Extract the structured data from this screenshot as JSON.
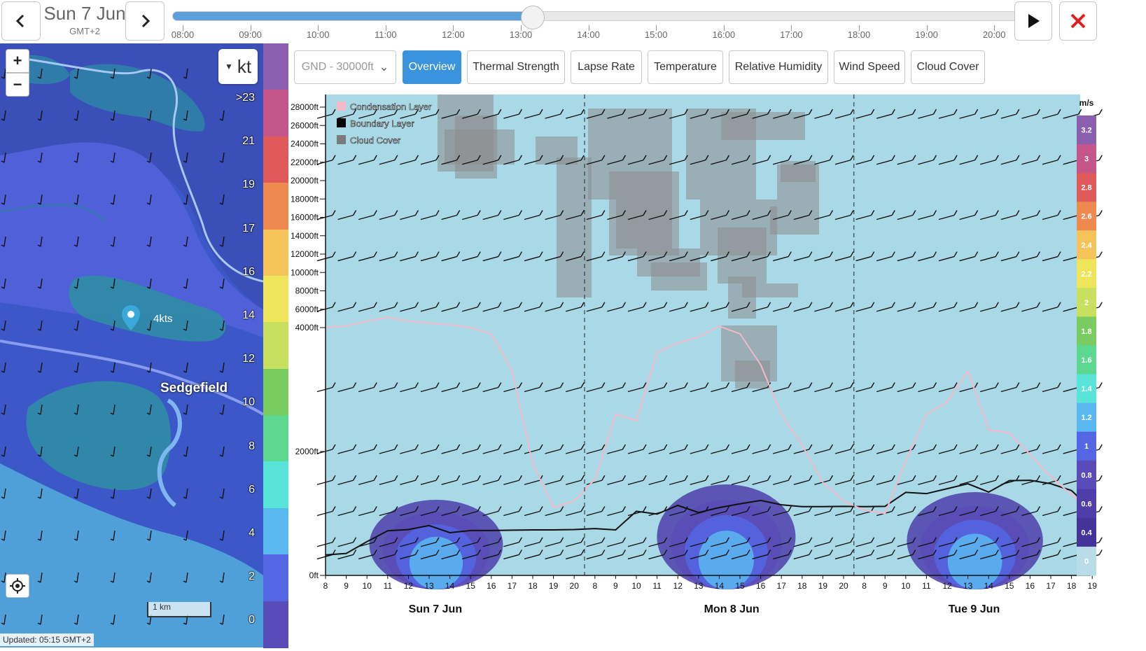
{
  "header": {
    "date": "Sun 7 Jun",
    "timezone": "GMT+2",
    "prev_icon": "chevron-left-icon",
    "next_icon": "chevron-right-icon",
    "play_icon": "play-icon",
    "close_icon": "close-icon",
    "close_color": "#e02020",
    "timeline_progress": 0.41,
    "timeline_labels": [
      "08:00",
      "09:00",
      "10:00",
      "11:00",
      "12:00",
      "13:00",
      "14:00",
      "15:00",
      "16:00",
      "17:00",
      "18:00",
      "19:00",
      "20:00"
    ]
  },
  "map": {
    "zoom_in": "+",
    "zoom_out": "−",
    "unit": "kt",
    "marker_label": "4kts",
    "place_label": "Sedgefield",
    "updated": "Updated: 05:15 GMT+2",
    "scale": "1 km",
    "locate_icon": "locate-icon",
    "legend_labels": [
      ">23",
      "21",
      "19",
      "17",
      "16",
      "14",
      "12",
      "10",
      "8",
      "6",
      "4",
      "2",
      "0"
    ],
    "legend_colors": [
      "#8a5fb0",
      "#c4568a",
      "#e05a5a",
      "#ee8a50",
      "#f4c45a",
      "#eee55a",
      "#c8e060",
      "#78cc60",
      "#5cd890",
      "#58e4d8",
      "#5ab8f0",
      "#5466e4",
      "#5a4cb8"
    ]
  },
  "tabs": {
    "altitude": "GND - 30000ft",
    "items": [
      "Overview",
      "Thermal Strength",
      "Lapse Rate",
      "Temperature",
      "Relative Humidity",
      "Wind Speed",
      "Cloud Cover"
    ],
    "active": "Overview"
  },
  "chart_data": {
    "type": "area",
    "legend": [
      "Condensation Layer",
      "Boundary Layer",
      "Cloud Cover"
    ],
    "legend_colors": [
      "#f4b8c8",
      "#000000",
      "#7a7a7a"
    ],
    "y_tick_labels": [
      "28000ft",
      "26000ft",
      "24000ft",
      "22000ft",
      "20000ft",
      "18000ft",
      "16000ft",
      "14000ft",
      "12000ft",
      "10000ft",
      "8000ft",
      "6000ft",
      "4000ft",
      "2000ft",
      "0ft"
    ],
    "x_tick_labels": [
      "8",
      "9",
      "10",
      "11",
      "12",
      "13",
      "14",
      "15",
      "16",
      "17",
      "18",
      "19",
      "20",
      "8",
      "9",
      "10",
      "11",
      "12",
      "13",
      "14",
      "15",
      "16",
      "17",
      "18",
      "19",
      "20",
      "8",
      "9",
      "10",
      "11",
      "12",
      "13",
      "14",
      "15",
      "16",
      "17",
      "18",
      "19"
    ],
    "day_labels": [
      "Sun 7 Jun",
      "Mon 8 Jun",
      "Tue 9 Jun"
    ],
    "unit": "m/s",
    "scale_labels": [
      "3.2",
      "3",
      "2.8",
      "2.6",
      "2.4",
      "2.2",
      "2",
      "1.8",
      "1.6",
      "1.4",
      "1.2",
      "1",
      "0.8",
      "0.6",
      "0.4",
      "0"
    ],
    "scale_colors": [
      "#8a5fb0",
      "#c4568a",
      "#e05a5a",
      "#ee8a50",
      "#f4c45a",
      "#eee55a",
      "#c8e060",
      "#78cc60",
      "#5cd890",
      "#58e4d8",
      "#5ab8f0",
      "#5466e4",
      "#5a4cb8",
      "#4e3eaa",
      "#443398",
      "#b8dce8"
    ],
    "plot_background": "#a9d8e6",
    "boundary_layer": [
      330,
      355,
      545,
      720,
      740,
      805,
      690,
      725,
      725,
      730,
      735,
      735,
      740,
      755,
      735,
      1035,
      990,
      1130,
      1015,
      1095,
      1155,
      1210,
      1140,
      1110,
      1110,
      1115,
      1110,
      1115,
      1340,
      1320,
      1400,
      1480,
      1345,
      1530,
      1535,
      1480,
      1370,
      1055
    ],
    "condensation_layer": [
      4000,
      4200,
      4700,
      5100,
      4700,
      4500,
      4300,
      4000,
      3900,
      3300,
      1800,
      1100,
      1200,
      1550,
      2600,
      2500,
      3600,
      3750,
      3850,
      4150,
      3900,
      3400,
      2600,
      2100,
      1500,
      1200,
      1050,
      1000,
      1850,
      2600,
      2800,
      3300,
      2350,
      2300,
      1950,
      1600,
      1300,
      1050
    ],
    "thermal_blobs": [
      {
        "center_hour": 13.0,
        "day": 0,
        "peak": 0.8
      },
      {
        "center_hour": 14.0,
        "day": 1,
        "peak": 1.0
      },
      {
        "center_hour": 13.0,
        "day": 2,
        "peak": 0.9
      }
    ]
  }
}
